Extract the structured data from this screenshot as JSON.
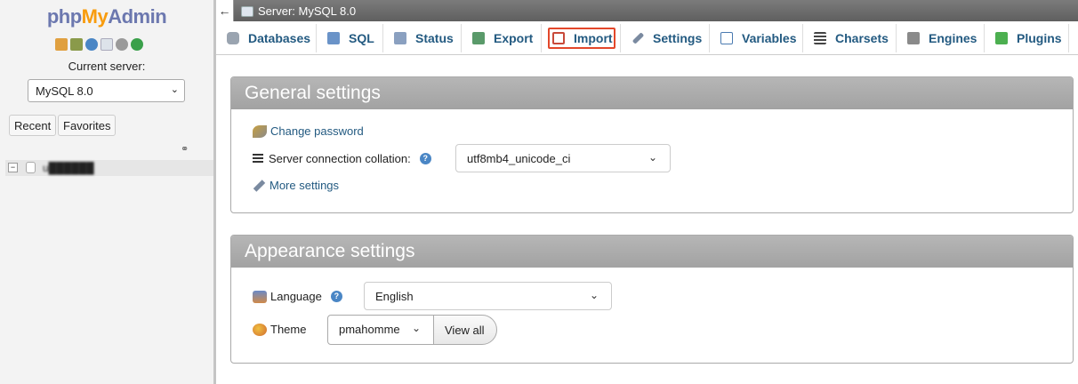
{
  "sidebar": {
    "logo": {
      "php": "php",
      "my": "My",
      "admin": "Admin"
    },
    "current_server_label": "Current server:",
    "server_value": "MySQL 8.0",
    "recent_label": "Recent",
    "favorites_label": "Favorites",
    "db_name": "u██████"
  },
  "topbar": {
    "collapse_glyph": "←",
    "title": "Server: MySQL 8.0"
  },
  "tabs": [
    {
      "label": "Databases",
      "icon": "database-icon",
      "color": "#9aa4b0"
    },
    {
      "label": "SQL",
      "icon": "sql-icon",
      "color": "#6a93c8"
    },
    {
      "label": "Status",
      "icon": "status-icon",
      "color": "#8aa0c0"
    },
    {
      "label": "Export",
      "icon": "export-icon",
      "color": "#5a9a6a"
    },
    {
      "label": "Import",
      "icon": "import-icon",
      "color": "#c84a3a"
    },
    {
      "label": "Settings",
      "icon": "wrench-icon",
      "color": "#7a8aa0"
    },
    {
      "label": "Variables",
      "icon": "variables-icon",
      "color": "#4a7ab0"
    },
    {
      "label": "Charsets",
      "icon": "charsets-icon",
      "color": "#444444"
    },
    {
      "label": "Engines",
      "icon": "engines-icon",
      "color": "#8a8a8a"
    },
    {
      "label": "Plugins",
      "icon": "plugin-icon",
      "color": "#4caf50"
    }
  ],
  "general": {
    "heading": "General settings",
    "change_password": "Change password",
    "collation_label": "Server connection collation:",
    "collation_value": "utf8mb4_unicode_ci",
    "more_settings": "More settings"
  },
  "appearance": {
    "heading": "Appearance settings",
    "language_label": "Language",
    "language_value": "English",
    "theme_label": "Theme",
    "theme_value": "pmahomme",
    "view_all": "View all"
  },
  "colors": {
    "accent_link": "#235a81",
    "highlight": "#e3472a"
  }
}
